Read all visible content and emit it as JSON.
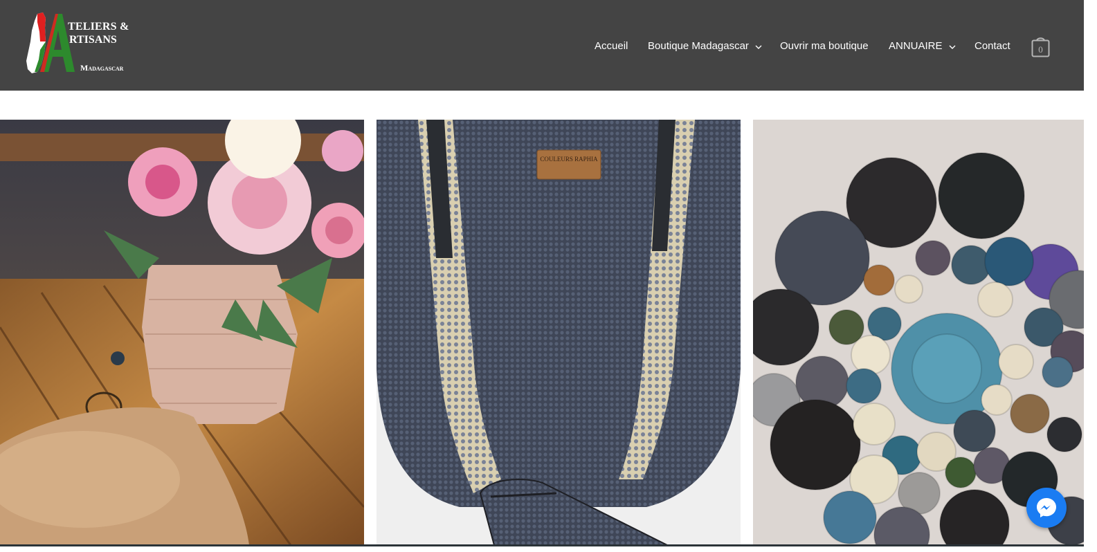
{
  "header": {
    "logo": {
      "line1": "TELIERS &",
      "line2": "RTISANS",
      "line3": "Madagascar"
    },
    "nav": [
      {
        "label": "Accueil",
        "has_dropdown": false
      },
      {
        "label": "Boutique Madagascar",
        "has_dropdown": true
      },
      {
        "label": "Ouvrir ma boutique",
        "has_dropdown": false
      },
      {
        "label": "ANNUAIRE",
        "has_dropdown": true
      },
      {
        "label": "Contact",
        "has_dropdown": false
      }
    ],
    "cart": {
      "count": "0",
      "icon": "shopping-bag-icon"
    }
  },
  "gallery": {
    "images": [
      {
        "name": "roses-in-raffia-vase",
        "icon": "photo"
      },
      {
        "name": "navy-raffia-tote-bag",
        "label": "COULEURS RAPHIA"
      },
      {
        "name": "raffia-circle-wall-decor",
        "icon": "photo"
      }
    ]
  },
  "colors": {
    "header_bg": "#444444",
    "logo_red": "#e02020",
    "logo_green": "#2d8a2d",
    "messenger": "#1a7cf2"
  },
  "messenger": {
    "icon": "messenger-icon"
  }
}
